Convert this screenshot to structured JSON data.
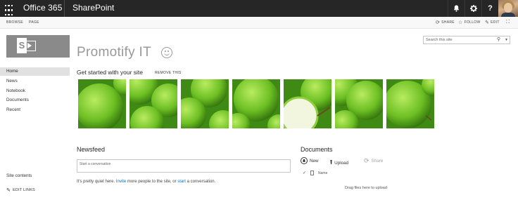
{
  "suite_bar": {
    "brand": "Office 365",
    "app": "SharePoint",
    "icons": [
      "app-launcher-icon",
      "bell-icon",
      "gear-icon",
      "help-icon"
    ]
  },
  "ribbon": {
    "tabs": [
      "BROWSE",
      "PAGE"
    ],
    "actions": [
      {
        "label": "SHARE",
        "icon": "share-icon"
      },
      {
        "label": "FOLLOW",
        "icon": "star-icon"
      },
      {
        "label": "EDIT",
        "icon": "pencil-icon"
      }
    ]
  },
  "site": {
    "title": "Promotify IT",
    "search_placeholder": "Search this site"
  },
  "left_nav": {
    "items": [
      "Home",
      "News",
      "Notebook",
      "Documents",
      "Recent"
    ],
    "selected": "Home",
    "site_contents": "Site contents",
    "edit_links": "EDIT LINKS"
  },
  "get_started": {
    "title": "Get started with your site",
    "remove": "REMOVE THIS",
    "tile_count": 7
  },
  "newsfeed": {
    "title": "Newsfeed",
    "placeholder": "Start a conversation",
    "quiet_prefix": "It's pretty quiet here.",
    "invite_link": "Invite",
    "quiet_middle": "more people to the site, or",
    "start_link": "start",
    "quiet_suffix": "a conversation."
  },
  "documents": {
    "title": "Documents",
    "new": "New",
    "upload": "Upload",
    "share": "Share",
    "column_name": "Name",
    "drag_hint": "Drag files here to upload"
  },
  "colors": {
    "suite_bar": "#262626",
    "accent": "#0072c6",
    "apple_green": "#6cbf23"
  }
}
